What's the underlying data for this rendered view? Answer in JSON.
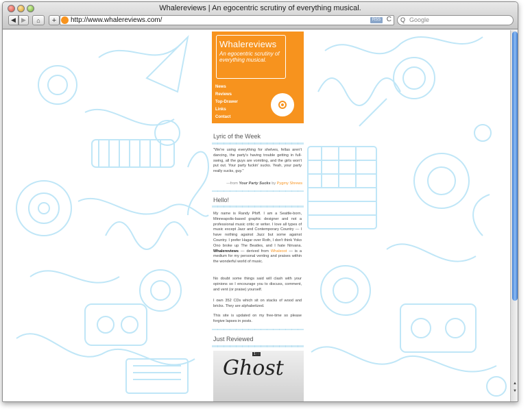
{
  "window": {
    "title": "Whalereviews | An egocentric scrutiny of everything musical."
  },
  "toolbar": {
    "back_icon": "◀",
    "forward_icon": "▶",
    "home_icon": "⌂",
    "add_icon": "+",
    "url": "http://www.whalereviews.com/",
    "rss_label": "RSS",
    "reload_icon": "C",
    "search_icon": "Q",
    "search_placeholder": "Google"
  },
  "site": {
    "name": "Whalereviews",
    "tagline": "An egocentric scrutiny of everything musical.",
    "menu": [
      "News",
      "Reviews",
      "Top-Drawer",
      "Links",
      "Contact"
    ],
    "accent_color": "#f7931e"
  },
  "lyric": {
    "heading": "Lyric of the Week",
    "text": "\"We're using everything for shelves, fellas aren't dancing, the party's having trouble getting in full-swing, all the guys are vomiting, and the girls won't put out. Your party fuckin' sucks. Yeah, your party really sucks, guy.\"",
    "source_prefix": "—from ",
    "song": "Your Party Sucks",
    "by": " by ",
    "artist": "Pygmy Shrews"
  },
  "hello": {
    "heading": "Hello!",
    "p1_a": "My name is Randy Pfoff. I am a Seattle-born, Minneapolis-based graphic designer and not a professional music critic or writer. I love all types of music except Jazz and Contemporary Country — I have nothing against Jazz but some against Country. I prefer Hagar over Roth, I don't think Yoko Ono broke up The Beatles, and I hate Nirvana. ",
    "p1_bold": "Whalereviews",
    "p1_b": " — derived from ",
    "p1_link": "Whaleoot",
    "p1_c": " — is a medium for my personal venting and praises within the wonderful world of music.",
    "p2": "No doubt some things said will clash with your opinions so I encourage you to discuss, comment, and vent (or praise) yourself.",
    "p3": "I own 352 CDs which sit on stacks of wood and bricks. They are alphabetized.",
    "p4": "This site is updated on my free-time so please forgive lapses in posts."
  },
  "just_reviewed": {
    "heading": "Just Reviewed",
    "cover_title": "Ghost",
    "cover_label": "1 : :"
  }
}
